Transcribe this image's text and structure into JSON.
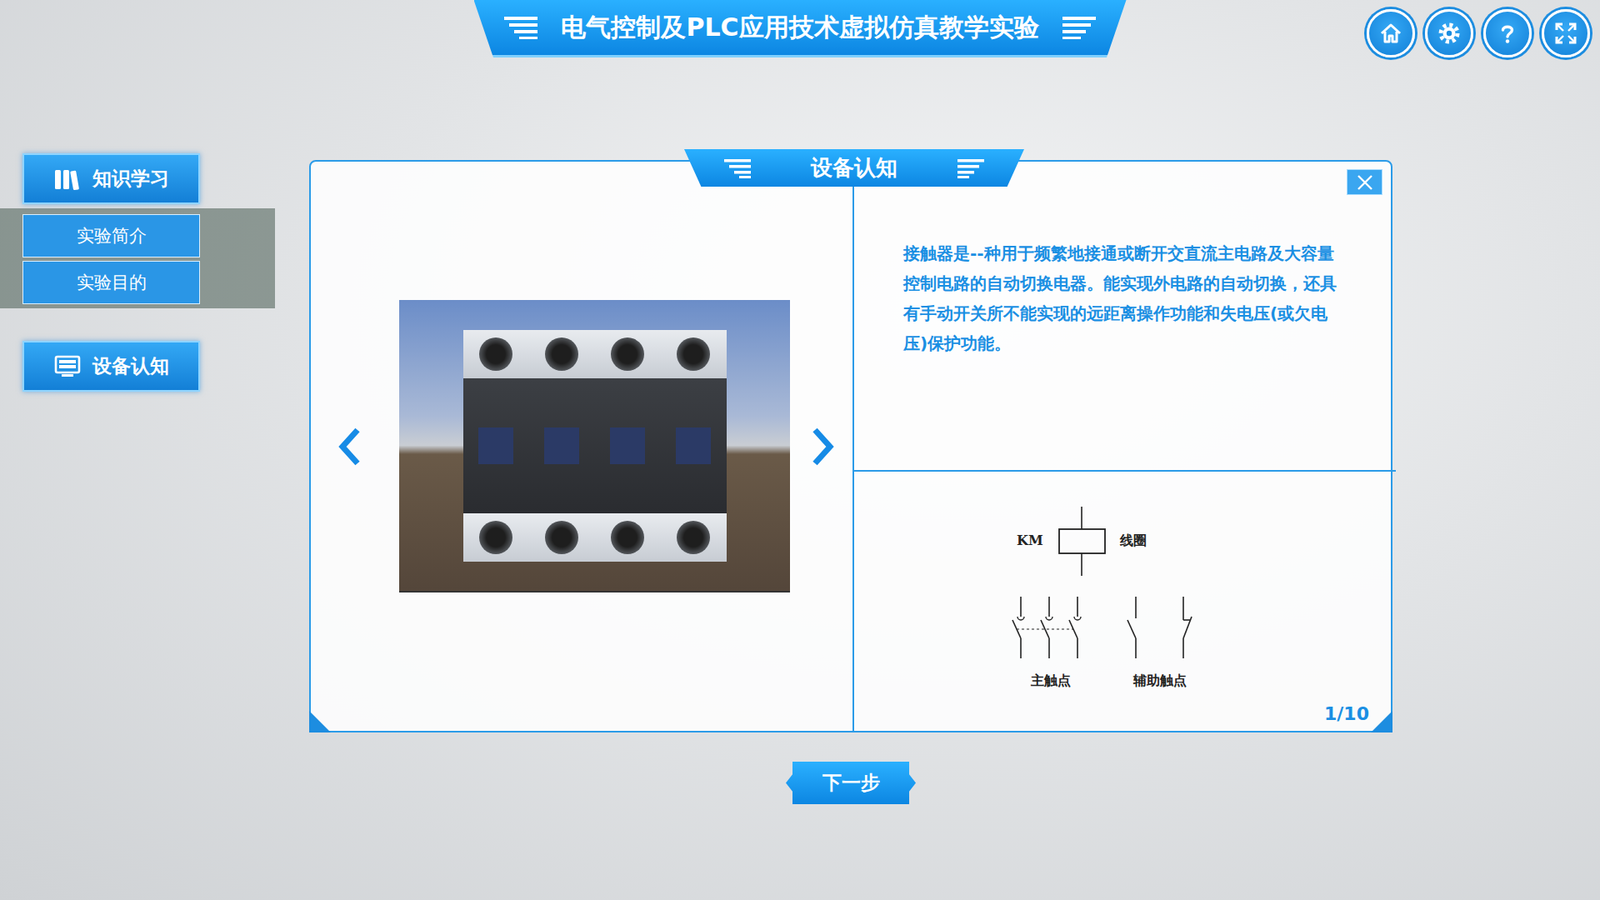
{
  "window": {
    "title": "电气控制及PLC应用技术虚拟仿真教学实验"
  },
  "sidebar": {
    "sections": [
      {
        "label": "知识学习",
        "items": [
          {
            "label": "实验简介",
            "selected": false
          },
          {
            "label": "实验目的",
            "selected": false
          }
        ]
      },
      {
        "label": "设备认知",
        "items": []
      }
    ]
  },
  "panel": {
    "title": "设备认知",
    "description": "接触器是--种用于频繁地接通或断开交直流主电路及大容量控制电路的自动切换电器。能实现外电路的自动切换，还具有手动开关所不能实现的远距离操作功能和失电压(或欠电压)保护功能。",
    "symbol": {
      "coil_tag": "KM",
      "coil_label": "线圈",
      "main_contacts_label": "主触点",
      "aux_contacts_label": "辅助触点"
    },
    "page": "1/10"
  },
  "next_button": {
    "label": "下一步"
  }
}
